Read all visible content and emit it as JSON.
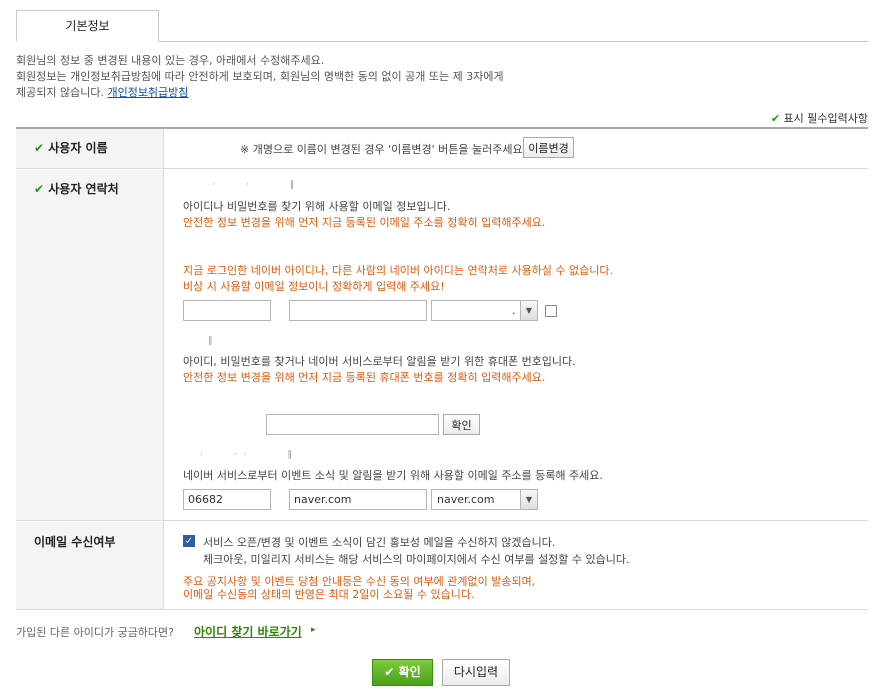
{
  "tabs": {
    "active": "기본정보"
  },
  "intro": {
    "line1": "회원님의 정보 중 변경된 내용이 있는 경우, 아래에서 수정해주세요.",
    "line2": "회원정보는 개인정보취급방침에 따라 안전하게 보호되며, 회원님의 명백한 동의 없이 공개 또는 제 3자에게",
    "line3": "제공되지 않습니다.",
    "policy_link": "개인정보취급방침"
  },
  "required_note": "표시 필수입력사항",
  "name_row": {
    "label": "사용자 이름",
    "note": "※ 개명으로 이름이 변경된 경우 '이름변경' 버튼을 눌러주세요.",
    "change_button": "이름변경"
  },
  "contact_row": {
    "label": "사용자 연락처",
    "email_desc": "아이디나 비밀번호를 찾기 위해 사용할 이메일 정보입니다.",
    "email_warn": "안전한 정보 변경을 위해 먼저 지금 등록된 이메일 주소를 정확히 입력해주세요.",
    "email_warn2": "지금 로그인한 네이버 아이디나, 다른 사람의 네이버 아이디는 연락처로 사용하실 수 없습니다.",
    "email_warn3": "비상 시 사용할 이메일 정보이니 정확하게 입력해 주세요!",
    "email_select_value": ".",
    "phone_desc": "아이디, 비밀번호를 찾거나 네이버 서비스로부터 알림을 받기 위한 휴대폰 번호입니다.",
    "phone_warn": "안전한 정보 변경을 위해 먼저 지금 등록된 휴대폰 번호를 정확히 입력해주세요.",
    "confirm_button": "확인",
    "event_email_desc": "네이버 서비스로부터 이벤트 소식 및 알림을 받기 위해 사용할 이메일 주소를 등록해 주세요.",
    "event_email_id": "06682",
    "event_email_domain": "naver.com",
    "event_email_select": "naver.com"
  },
  "email_opt_row": {
    "label": "이메일 수신여부",
    "checkbox_label": "서비스 오픈/변경 및 이벤트 소식이 담긴 홍보성 메일을 수신하지 않겠습니다.",
    "checkbox_sub": "체크아웃, 미일리지 서비스는 해당 서비스의 마이페이지에서 수신 여부를 설정할 수 있습니다.",
    "warn1": "주요 공지사항 및 이벤트 당첨 안내등은 수신 동의 여부에 관계없이 발송되며,",
    "warn2": "이메일 수신동의 상태의 반영은 최대 2일이 소요될 수 있습니다."
  },
  "footer": {
    "question": "가입된 다른 아이디가 궁금하다면?",
    "find_link": "아이디 찾기 바로가기",
    "ok_button": "확인",
    "reset_button": "다시입력"
  },
  "colors": {
    "accent_green": "#4aa016",
    "warning_orange": "#e05a0c",
    "link_blue": "#0b4fa8"
  }
}
